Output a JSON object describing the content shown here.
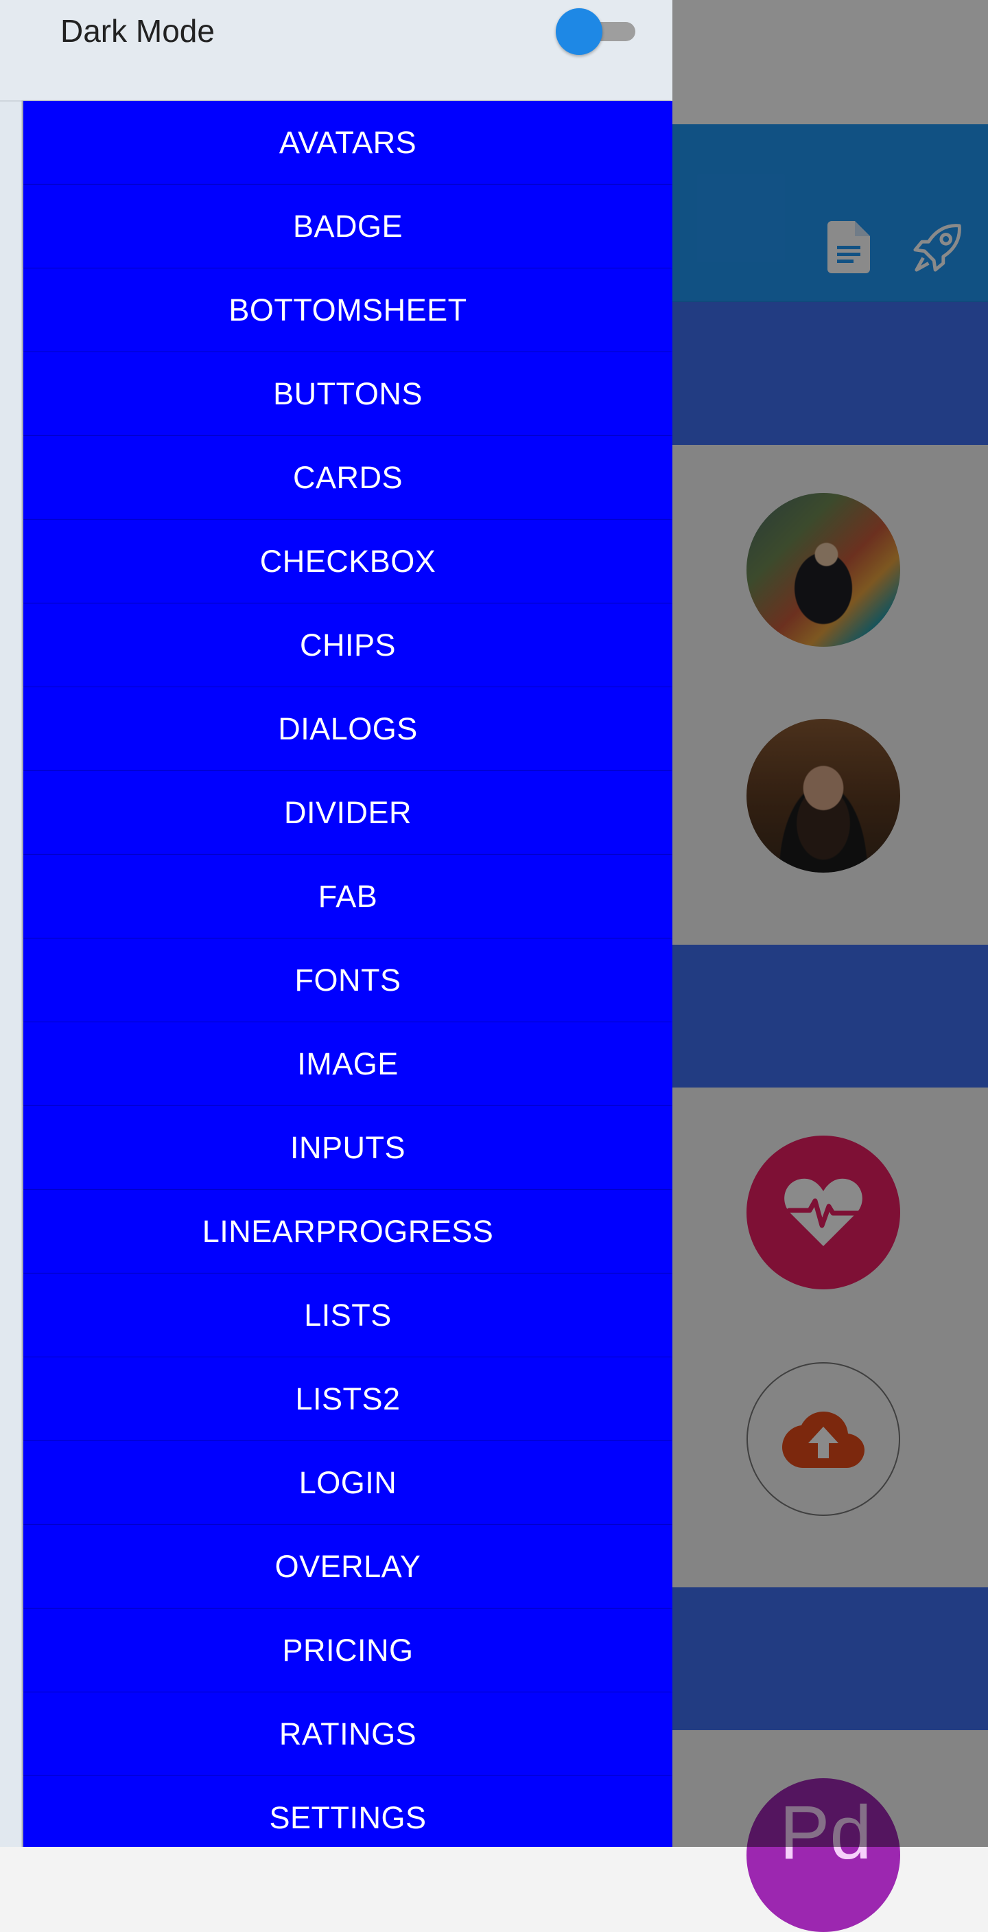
{
  "drawer": {
    "dark_mode_label": "Dark Mode",
    "dark_mode_enabled": false,
    "menu_items": [
      {
        "label": "AVATARS"
      },
      {
        "label": "BADGE"
      },
      {
        "label": "BOTTOMSHEET"
      },
      {
        "label": "BUTTONS"
      },
      {
        "label": "CARDS"
      },
      {
        "label": "CHECKBOX"
      },
      {
        "label": "CHIPS"
      },
      {
        "label": "DIALOGS"
      },
      {
        "label": "DIVIDER"
      },
      {
        "label": "FAB"
      },
      {
        "label": "FONTS"
      },
      {
        "label": "IMAGE"
      },
      {
        "label": "INPUTS"
      },
      {
        "label": "LINEARPROGRESS"
      },
      {
        "label": "LISTS"
      },
      {
        "label": "LISTS2"
      },
      {
        "label": "LOGIN"
      },
      {
        "label": "OVERLAY"
      },
      {
        "label": "PRICING"
      },
      {
        "label": "RATINGS"
      },
      {
        "label": "SETTINGS"
      }
    ]
  },
  "background": {
    "appbar_icons": [
      "document-icon",
      "rocket-icon"
    ],
    "purple_avatar_text": "Pd"
  },
  "colors": {
    "menu_item_bg": "#0000ff",
    "menu_item_text": "#ffffff",
    "toggle_thumb": "#1e88e5",
    "appbar": "#2196f3",
    "section_header": "#3f6ff0",
    "heart_circle": "#e91e63",
    "upload_icon": "#e64a19",
    "purple_avatar": "#9c27b0"
  }
}
